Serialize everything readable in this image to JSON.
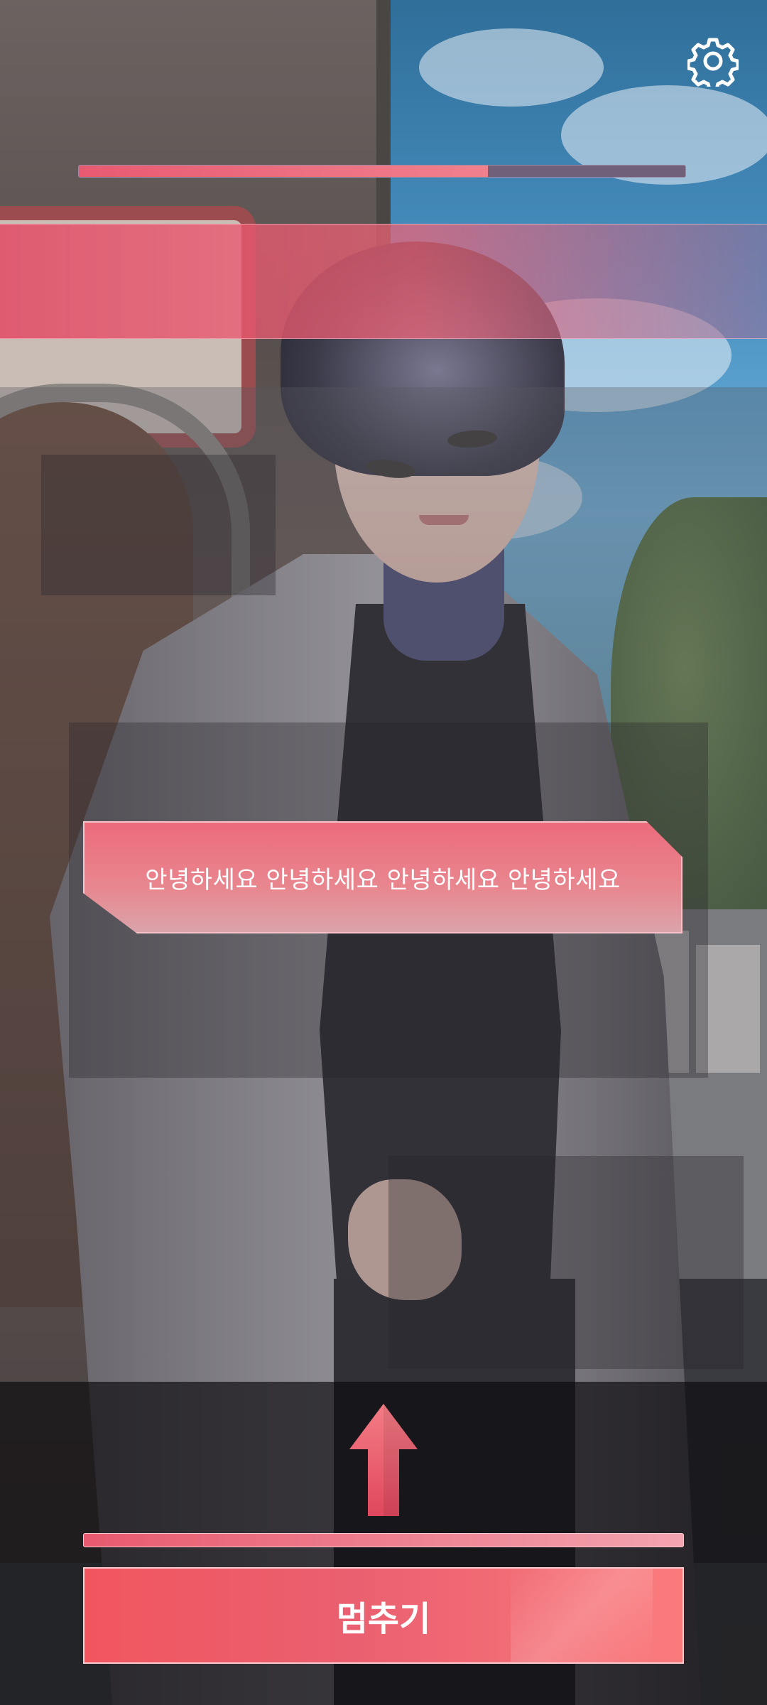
{
  "settings": {
    "icon": "gear-icon"
  },
  "progress": {
    "fraction": 0.675
  },
  "dialogue": {
    "text": "안녕하세요 안녕하세요 안녕하세요 안녕하세요"
  },
  "controls": {
    "up_icon": "up-arrow-icon",
    "stop_label": "멈추기"
  },
  "colors": {
    "accent": "#ea6070",
    "bubble": "#ec6b7c",
    "progress_fill": "#e85a72"
  }
}
